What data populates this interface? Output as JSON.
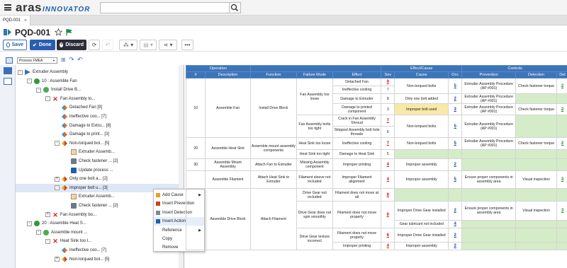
{
  "header": {
    "brand": "aras",
    "brand_sub": "INNOVATOR",
    "search_placeholder": ""
  },
  "tabs": [
    {
      "label": "PQD-001"
    }
  ],
  "page": {
    "title": "PQD-001"
  },
  "toolbar": {
    "save_label": "Save",
    "done_label": "Done",
    "discard_label": "Discard"
  },
  "view_select": {
    "value": "Process FMEA"
  },
  "tree": [
    {
      "label": "Extruder Assembly",
      "depth": 0,
      "icon": "root",
      "exp": "-"
    },
    {
      "label": "10 : Assemble Fan",
      "depth": 1,
      "icon": "op",
      "exp": "-"
    },
    {
      "label": "Install Drive B...",
      "depth": 2,
      "icon": "fn",
      "exp": "-"
    },
    {
      "label": "Fan Assembly to...",
      "depth": 3,
      "icon": "fm",
      "exp": "-"
    },
    {
      "label": "Detached Fan [9]",
      "depth": 4,
      "icon": "ef",
      "exp": ""
    },
    {
      "label": "Ineffective coo... [7]",
      "depth": 4,
      "icon": "ef",
      "exp": ""
    },
    {
      "label": "Damage to Extru... [8]",
      "depth": 4,
      "icon": "ef",
      "exp": ""
    },
    {
      "label": "Damage to print... [3]",
      "depth": 4,
      "icon": "ef",
      "exp": ""
    },
    {
      "label": "Non-torqued bol... [5]",
      "depth": 4,
      "icon": "ca",
      "exp": "-"
    },
    {
      "label": "Extruder Assemb...",
      "depth": 5,
      "icon": "pv",
      "exp": ""
    },
    {
      "label": "Check fastener ... [2]",
      "depth": 5,
      "icon": "dt",
      "exp": ""
    },
    {
      "label": "Update process ...",
      "depth": 5,
      "icon": "ac",
      "exp": ""
    },
    {
      "label": "Only one bolt a... [2]",
      "depth": 4,
      "icon": "ca",
      "exp": "+"
    },
    {
      "label": "Improper bolt u... [3]",
      "depth": 4,
      "icon": "ca",
      "exp": "-",
      "sel": true
    },
    {
      "label": "Extruder Assemb...",
      "depth": 5,
      "icon": "pv",
      "exp": ""
    },
    {
      "label": "Check fastener ... [2]",
      "depth": 5,
      "icon": "dt",
      "exp": ""
    },
    {
      "label": "Fan Assembly bo...",
      "depth": 3,
      "icon": "fm",
      "exp": "+"
    },
    {
      "label": "20 : Assemble Heat S...",
      "depth": 1,
      "icon": "op",
      "exp": "-"
    },
    {
      "label": "Assemble mount ...",
      "depth": 2,
      "icon": "fn",
      "exp": "-"
    },
    {
      "label": "Heat Sink too l...",
      "depth": 3,
      "icon": "fm",
      "exp": "-"
    },
    {
      "label": "Ineffective coo... [7]",
      "depth": 4,
      "icon": "ef",
      "exp": ""
    },
    {
      "label": "Non-torqued bol... [5]",
      "depth": 4,
      "icon": "ca",
      "exp": "+"
    }
  ],
  "context_menu": [
    {
      "label": "Add Cause",
      "sub": true
    },
    {
      "label": "Insert Prevention",
      "sub": false
    },
    {
      "label": "Insert Detection",
      "sub": false
    },
    {
      "label": "Insert Action",
      "sub": false,
      "hl": true
    },
    {
      "label": "Reference",
      "sub": true
    },
    {
      "label": "Copy",
      "sub": false
    },
    {
      "label": "Remove",
      "sub": false
    }
  ],
  "grid": {
    "group_headers": [
      "Operation",
      "Effect/Cause",
      "Controls"
    ],
    "columns": [
      "#",
      "Description",
      "Function",
      "Failure Mode",
      "Effect",
      "Sev",
      "Cause",
      "Occ",
      "Prevention",
      "Detection",
      "Det"
    ],
    "cells": {
      "op10": "10",
      "op10d": "Assemble Fan",
      "fn1": "Install Drive Block",
      "fm1": "Fan Assembly too loose",
      "e1": "Detached Fan",
      "s1": "9",
      "e2": "Ineffective cooling",
      "s2": "7",
      "e3": "Damage to Extruder",
      "s3": "8",
      "e4": "Damage to printed component",
      "s4": "3",
      "c1": "Non-torqued bolts",
      "o1": "5",
      "p1": "Extruder Assembly Procedure (AP #001)",
      "d1": "Check fastener torque",
      "dn1": "2",
      "c2": "Only one bolt added",
      "o2": "2",
      "p2": "Extruder Assembly Procedure (AP #001)",
      "c3": "Improper bolt used",
      "o3": "3",
      "p3": "Extruder Assembly Procedure (AP #001)",
      "d3": "Check fastener torque",
      "dn3": "2",
      "fm2": "Fan Assembly bolts too tight",
      "e5": "Crack in Fan Assembly Shroud",
      "s5": "7",
      "e6": "Stripped Assembly bolt hole threads",
      "s6": "6",
      "c4": "Non-torqued bolts",
      "o4": "5",
      "p4": "Extruder Assembly Procedure (AP #001)",
      "op20": "20",
      "op20d": "Assemble Heat Sink",
      "fn2": "Assemble mount assembly components",
      "fm3": "Heat Sink too loose",
      "e7": "Ineffective cooling",
      "s7": "7",
      "c5": "Non-torqued bolts",
      "o5": "5",
      "p5": "Extruder Assembly Procedure (AP #001)",
      "d5": "Check fastener torque",
      "dn5": "2",
      "fm4": "Heat Sink too tight",
      "e8": "Damage to Heat Sink",
      "s8": "5",
      "op30": "30",
      "op30d": "Assemble Mount Assembly",
      "fn3": "Attach Fan to Extruder",
      "fm5": "Missing Assembly component",
      "e9": "Improper printing",
      "s9": "4",
      "c6": "Improper assembly",
      "o6": "2",
      "op40d": "Assemble Filament",
      "fn4": "Attach Heat Sink to Extruder",
      "fm6": "Filament sleeve not included",
      "e10": "Improper Filament alignment",
      "s10": "4",
      "c7": "Improper assembly",
      "o7": "5",
      "p7": "Ensure proper components in assembly area",
      "d7": "Visual inspection",
      "dn7": "3",
      "op50d": "Assemble Drive Block",
      "fn5": "Attach Filament",
      "fm7": "Drive Gear not included",
      "e11": "Filament does not move at all",
      "s11": "8",
      "fm8": "Drive Gear does not spin smoothly",
      "e12": "Filament does not move properly",
      "s12": "6",
      "c8": "Improper Drive Gear installed",
      "o8": "2",
      "p8": "Ensure proper components in assembly area",
      "d8": "Visual inspection",
      "dn8": "3",
      "c9": "Gear lubricant not included",
      "o9": "4",
      "fm9": "Drive Gear texture incorrect",
      "e13": "Filament does not move properly",
      "s13": "6",
      "c10": "Improper Drive Gear installed",
      "o10": "2",
      "e14": "Improper printing",
      "s14": "4",
      "c11": "Improper assembly",
      "o11": "2"
    }
  }
}
